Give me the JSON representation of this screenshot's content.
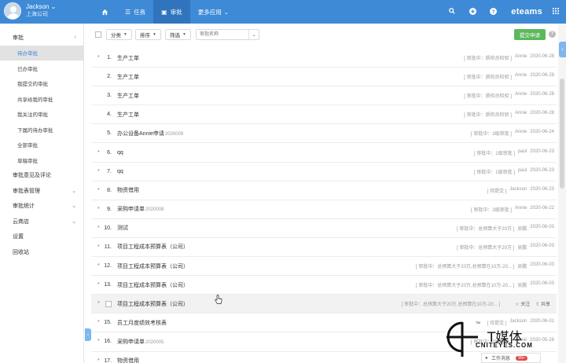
{
  "header": {
    "user_name": "Jackson",
    "user_company": "上海公司",
    "nav": [
      {
        "label": "任务",
        "icon": "list-icon"
      },
      {
        "label": "审批",
        "icon": "approval-icon"
      },
      {
        "label": "更多应用",
        "icon": "chevron-down-icon"
      }
    ],
    "logo": "eteams"
  },
  "sidebar": {
    "items": [
      {
        "label": "审批",
        "arrow": "›"
      },
      {
        "label": "待办审批"
      },
      {
        "label": "已办审批"
      },
      {
        "label": "我提交的审批"
      },
      {
        "label": "共享给我的审批"
      },
      {
        "label": "我关注的审批"
      },
      {
        "label": "下属的待办审批"
      },
      {
        "label": "全部审批"
      },
      {
        "label": "草稿审批"
      },
      {
        "label": "审批意见及评论"
      },
      {
        "label": "审批表管理",
        "arrow": "⌄"
      },
      {
        "label": "审批统计",
        "arrow": "⌄"
      },
      {
        "label": "云商店",
        "arrow": "⌄"
      },
      {
        "label": "设置"
      },
      {
        "label": "回收站"
      }
    ]
  },
  "toolbar": {
    "group_label": "分类",
    "sort_label": "排序",
    "filter_label": "筛选",
    "search_placeholder": "审批名称",
    "submit_label": "提交申请",
    "help_label": "?"
  },
  "rows": [
    {
      "num": "1.",
      "star": true,
      "title": "生产工单",
      "suffix": "",
      "meta": [
        "[ 审批中：质检员检验 ]",
        "Annie",
        "2020-06-28"
      ]
    },
    {
      "num": "2.",
      "star": false,
      "title": "生产工单",
      "suffix": "",
      "meta": [
        "[ 审批中：质检员检验 ]",
        "Annie",
        "2020-06-28"
      ]
    },
    {
      "num": "3.",
      "star": false,
      "title": "生产工单",
      "suffix": "",
      "meta": [
        "[ 审批中：质检员检验 ]",
        "Annie",
        "2020-06-28"
      ]
    },
    {
      "num": "4.",
      "star": false,
      "title": "生产工单",
      "suffix": "",
      "meta": [
        "[ 审批中：质检员检验 ]",
        "Annie",
        "2020-06-28"
      ]
    },
    {
      "num": "5.",
      "star": false,
      "title": "办公设备Annie申请",
      "suffix": "2020009",
      "meta": [
        "[ 审批中：3级审批 ]",
        "Annie",
        "2020-06-24"
      ]
    },
    {
      "num": "6.",
      "star": true,
      "title": "qq",
      "suffix": "",
      "meta": [
        "[ 审批中：1级审批 ]",
        "paul",
        "2020-06-23"
      ]
    },
    {
      "num": "7.",
      "star": true,
      "title": "qq",
      "suffix": "",
      "meta": [
        "[ 审批中：1级审批 ]",
        "paul",
        "2020-06-23"
      ]
    },
    {
      "num": "8.",
      "star": true,
      "title": "物资借用",
      "suffix": "",
      "meta": [
        "[ 待提交 ]",
        "Jackson",
        "2020-06-23"
      ]
    },
    {
      "num": "9.",
      "star": true,
      "title": "采购申请单",
      "suffix": "2020008",
      "meta": [
        "[ 审批中：3级审批 ]",
        "Annie",
        "2020-06-22"
      ]
    },
    {
      "num": "10.",
      "star": true,
      "title": "测试",
      "suffix": "",
      "meta": [
        "[ 审批中：总预算大于20万 ]",
        "吴鹏",
        "2020-06-03"
      ]
    },
    {
      "num": "11.",
      "star": true,
      "title": "项目工程成本预算表（公司）",
      "suffix": "",
      "meta": [
        "[ 审批中：总预算大于20万 ]",
        "吴鹏",
        "2020-06-03"
      ]
    },
    {
      "num": "12.",
      "star": true,
      "title": "项目工程成本预算表（公司）",
      "suffix": "",
      "meta": [
        "[ 审批中：总预算大于20万,总预算在10万-20... ]",
        "吴鹏",
        "2020-06-03"
      ]
    },
    {
      "num": "13.",
      "star": true,
      "title": "项目工程成本预算表（公司）",
      "suffix": "",
      "meta": [
        "[ 审批中：总预算大于20万,总预算在10万-20... ]",
        "吴鹏",
        "2020-06-03"
      ]
    },
    {
      "num": "",
      "star": true,
      "title": "项目工程成本预算表（公司）",
      "suffix": "",
      "meta": [
        "[ 审批中：总预算大于20万,总预算在10万-20... ]"
      ],
      "hover": true,
      "actions": [
        "☆ 关注",
        "⇪ 共享"
      ]
    },
    {
      "num": "15.",
      "star": true,
      "title": "员工月度绩效考核表",
      "suffix": "",
      "meta": [
        "[ 待提交 ]",
        "Jackson",
        "2020-06-01"
      ]
    },
    {
      "num": "16.",
      "star": true,
      "title": "采购申请单",
      "suffix": "2020005",
      "meta": [
        "[ 审批中：3级审批 ]",
        "Annie",
        "2020-05-28"
      ]
    },
    {
      "num": "17.",
      "star": true,
      "title": "物资借用",
      "suffix": "",
      "meta": []
    }
  ],
  "watermark": {
    "brand": "T媒体",
    "site": "CNITEYES.COM",
    "tm": "TM"
  },
  "work_message": {
    "label": "工作消息",
    "badge": "99+"
  }
}
